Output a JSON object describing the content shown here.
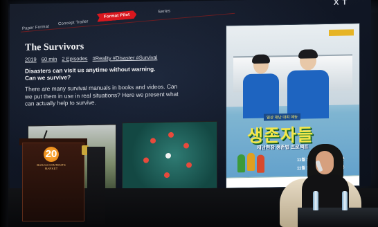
{
  "tabs": {
    "paper": "Paper Format",
    "concept": "Concept Trailer",
    "active": "Format Pilot",
    "series": "Series"
  },
  "corner_text": "X T",
  "slide": {
    "title": "The Survivors",
    "meta": [
      "2019",
      "60 min",
      "2 Episodes",
      "#Reality #Disaster #Survival"
    ],
    "lead_1": "Disasters can visit us anytime without warning.",
    "lead_2": "Can we survive?",
    "body_1": "There are many survival manuals in books and videos. Can",
    "body_2": "we put them in use in real situations? Here we present what",
    "body_3": "can actually help to survive."
  },
  "poster": {
    "badge": "",
    "tagline": "일상 재난 대피 예능",
    "title": "생존자들",
    "subtitle": "재난현장 생존법 프로젝트",
    "air_1": "11월 12일 (화) 밤 8시 55분",
    "air_2": "11월 13일 (화) 밤 8시 55분"
  },
  "podium": {
    "logo_number": "20",
    "logo_text": "BUSAN CONTENTS MARKET"
  }
}
